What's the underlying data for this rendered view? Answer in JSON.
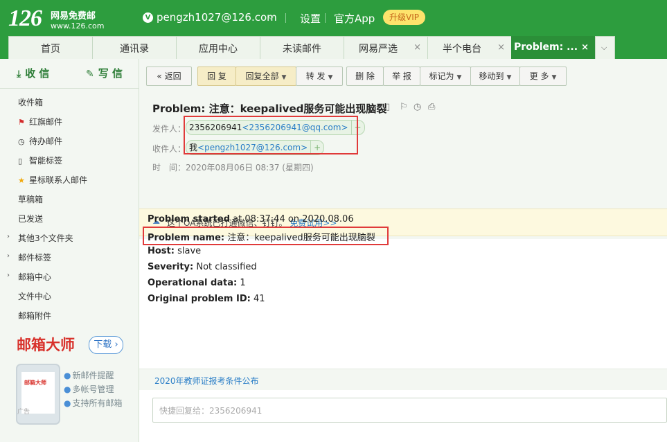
{
  "header": {
    "logo_number": "126",
    "logo_name": "网易免费邮",
    "logo_domain": "www.126.com",
    "account_icon": "V",
    "account": "pengzh1027@126.com",
    "settings": "设置",
    "official_app": "官方App",
    "upgrade_vip": "升级VIP"
  },
  "tabs": [
    {
      "label": "首页"
    },
    {
      "label": "通讯录"
    },
    {
      "label": "应用中心"
    },
    {
      "label": "未读邮件"
    },
    {
      "label": "网易严选",
      "close": "×"
    },
    {
      "label": "半个电台",
      "close": "×"
    },
    {
      "label": "Problem: ...",
      "close": "×"
    }
  ],
  "sidebar": {
    "receive": "收 信",
    "compose": "写 信",
    "items": [
      {
        "label": "收件箱"
      },
      {
        "label": "红旗邮件"
      },
      {
        "label": "待办邮件"
      },
      {
        "label": "智能标签"
      },
      {
        "label": "星标联系人邮件"
      },
      {
        "label": "草稿箱"
      },
      {
        "label": "已发送"
      },
      {
        "label": "其他3个文件夹"
      },
      {
        "label": "邮件标签"
      },
      {
        "label": "邮箱中心"
      },
      {
        "label": "文件中心"
      },
      {
        "label": "邮箱附件"
      }
    ],
    "ad": {
      "title": "邮箱大师",
      "download": "下载",
      "phone_logo": "邮箱大师",
      "points": [
        "新邮件提醒",
        "多帐号管理",
        "支持所有邮箱"
      ],
      "tag": "广告"
    }
  },
  "toolbar": {
    "back": "返回",
    "reply": "回 复",
    "reply_all": "回复全部",
    "forward": "转 发",
    "delete": "删 除",
    "report": "举 报",
    "mark_as": "标记为",
    "move_to": "移动到",
    "more": "更 多"
  },
  "mail": {
    "subject": "Problem: 注意：keepalived服务可能出现脑裂",
    "from_label": "发件人：",
    "from_name": "2356206941",
    "from_email": "<2356206941@qq.com>",
    "to_label": "收件人：",
    "to_name": "我",
    "to_email": "<pengzh1027@126.com>",
    "time_label": "时　间：",
    "time_value": "2020年08月06日 08:37 (星期四)",
    "oa_text": "这个OA系统已打通微信、钉钉。",
    "oa_link": "免费试用>>"
  },
  "body": [
    {
      "key": "Problem started",
      "value": " at 08:37:44 on 2020.08.06"
    },
    {
      "key": "Problem name:",
      "value": " 注意：keepalived服务可能出现脑裂"
    },
    {
      "key": "Host:",
      "value": " slave"
    },
    {
      "key": "Severity:",
      "value": " Not classified"
    },
    {
      "key": "Operational data:",
      "value": " 1"
    },
    {
      "key": "Original problem ID:",
      "value": " 41"
    }
  ],
  "news_link": "2020年教师证报考条件公布",
  "quick_reply_placeholder": "快捷回复给：2356206941"
}
